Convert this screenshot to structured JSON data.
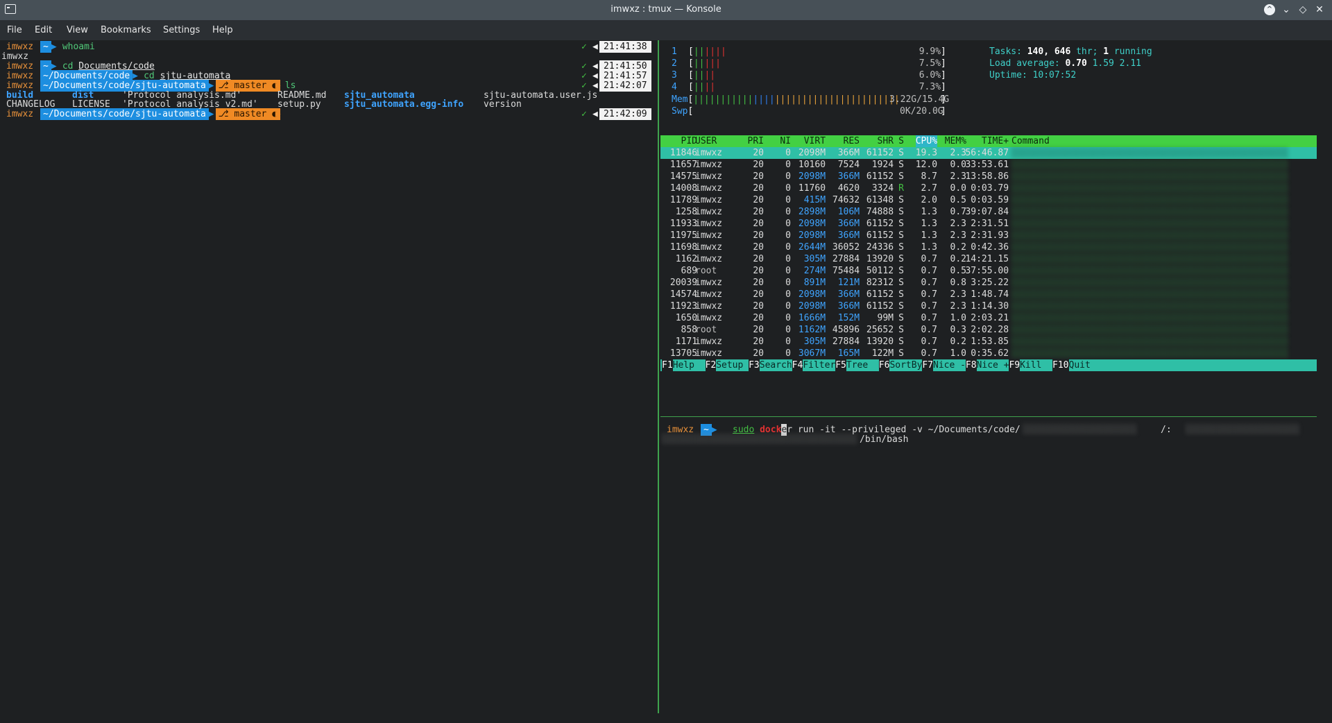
{
  "window": {
    "title": "imwxz : tmux — Konsole",
    "icons": [
      "terminal-icon",
      "keep-above-icon",
      "minimize-icon",
      "maximize-icon",
      "close-icon"
    ]
  },
  "menu": [
    "File",
    "Edit",
    "View",
    "Bookmarks",
    "Settings",
    "Help"
  ],
  "left_pane": {
    "prompts": [
      {
        "user": "imwxz",
        "path": "~",
        "cmd": "whoami",
        "arg": "",
        "branch": "",
        "time": "21:41:38"
      },
      {
        "user": "imwxz",
        "path": "~",
        "cmd": "cd",
        "arg": "Documents/code",
        "branch": "",
        "time": "21:41:50"
      },
      {
        "user": "imwxz",
        "path": "~/Documents/code",
        "cmd": "cd",
        "arg": "sjtu-automata",
        "branch": "",
        "time": "21:41:57"
      },
      {
        "user": "imwxz",
        "path": "~/Documents/code/sjtu-automata",
        "cmd": "ls",
        "arg": "",
        "branch": "master ●",
        "time": "21:42:07"
      },
      {
        "user": "imwxz",
        "path": "~/Documents/code/sjtu-automata",
        "cmd": "",
        "arg": "",
        "branch": "master ●",
        "time": "21:42:09"
      }
    ],
    "whoami_output": "imwxz",
    "ls_row1": [
      "build",
      "dist",
      "'Protocol analysis.md'",
      "README.md",
      "sjtu_automata",
      "sjtu-automata.user.js"
    ],
    "ls_row2": [
      "CHANGELOG",
      "LICENSE",
      "'Protocol analysis v2.md'",
      "setup.py",
      "sjtu_automata.egg-info",
      "version"
    ]
  },
  "htop": {
    "cpus": [
      {
        "n": "1",
        "pct": "9.9%",
        "fill": 0.099
      },
      {
        "n": "2",
        "pct": "7.5%",
        "fill": 0.075
      },
      {
        "n": "3",
        "pct": "6.0%",
        "fill": 0.06
      },
      {
        "n": "4",
        "pct": "7.3%",
        "fill": 0.073
      }
    ],
    "mem_label": "Mem",
    "mem_value": "3.22G/15.4G",
    "swp_label": "Swp",
    "swp_value": "0K/20.0G",
    "tasks_label": "Tasks:",
    "tasks": "140,",
    "thr": "646",
    "thr_label": "thr;",
    "running": "1",
    "running_label": "running",
    "load_label": "Load average:",
    "load1": "0.70",
    "load5": "1.59",
    "load15": "2.11",
    "uptime_label": "Uptime:",
    "uptime": "10:07:52",
    "columns": [
      "PID",
      "USER",
      "PRI",
      "NI",
      "VIRT",
      "RES",
      "SHR",
      "S",
      "CPU%",
      "MEM%",
      "TIME+",
      "Command"
    ],
    "rows": [
      [
        "11846",
        "imwxz",
        "20",
        "0",
        "2098M",
        "366M",
        "61152",
        "S",
        "19.3",
        "2.3",
        "56:46.87"
      ],
      [
        "11657",
        "imwxz",
        "20",
        "0",
        "10160",
        "7524",
        "1924",
        "S",
        "12.0",
        "0.0",
        "33:53.61"
      ],
      [
        "14575",
        "imwxz",
        "20",
        "0",
        "2098M",
        "366M",
        "61152",
        "S",
        "8.7",
        "2.3",
        "13:58.86"
      ],
      [
        "14008",
        "imwxz",
        "20",
        "0",
        "11760",
        "4620",
        "3324",
        "R",
        "2.7",
        "0.0",
        "0:03.79"
      ],
      [
        "11789",
        "imwxz",
        "20",
        "0",
        "415M",
        "74632",
        "61348",
        "S",
        "2.0",
        "0.5",
        "0:03.59"
      ],
      [
        "1258",
        "imwxz",
        "20",
        "0",
        "2898M",
        "106M",
        "74888",
        "S",
        "1.3",
        "0.7",
        "39:07.84"
      ],
      [
        "11933",
        "imwxz",
        "20",
        "0",
        "2098M",
        "366M",
        "61152",
        "S",
        "1.3",
        "2.3",
        "2:31.51"
      ],
      [
        "11975",
        "imwxz",
        "20",
        "0",
        "2098M",
        "366M",
        "61152",
        "S",
        "1.3",
        "2.3",
        "2:31.93"
      ],
      [
        "11698",
        "imwxz",
        "20",
        "0",
        "2644M",
        "36052",
        "24336",
        "S",
        "1.3",
        "0.2",
        "0:42.36"
      ],
      [
        "1162",
        "imwxz",
        "20",
        "0",
        "305M",
        "27884",
        "13920",
        "S",
        "0.7",
        "0.2",
        "14:21.15"
      ],
      [
        "689",
        "root",
        "20",
        "0",
        "274M",
        "75484",
        "50112",
        "S",
        "0.7",
        "0.5",
        "37:55.00"
      ],
      [
        "20039",
        "imwxz",
        "20",
        "0",
        "891M",
        "121M",
        "82312",
        "S",
        "0.7",
        "0.8",
        "3:25.22"
      ],
      [
        "14574",
        "imwxz",
        "20",
        "0",
        "2098M",
        "366M",
        "61152",
        "S",
        "0.7",
        "2.3",
        "1:48.74"
      ],
      [
        "11923",
        "imwxz",
        "20",
        "0",
        "2098M",
        "366M",
        "61152",
        "S",
        "0.7",
        "2.3",
        "1:14.30"
      ],
      [
        "1650",
        "imwxz",
        "20",
        "0",
        "1666M",
        "152M",
        "99M",
        "S",
        "0.7",
        "1.0",
        "2:03.21"
      ],
      [
        "858",
        "root",
        "20",
        "0",
        "1162M",
        "45896",
        "25652",
        "S",
        "0.7",
        "0.3",
        "2:02.28"
      ],
      [
        "1171",
        "imwxz",
        "20",
        "0",
        "305M",
        "27884",
        "13920",
        "S",
        "0.7",
        "0.2",
        "1:53.85"
      ],
      [
        "13705",
        "imwxz",
        "20",
        "0",
        "3067M",
        "165M",
        "122M",
        "S",
        "0.7",
        "1.0",
        "0:35.62"
      ]
    ],
    "fkeys": [
      {
        "key": "F1",
        "label": "Help  "
      },
      {
        "key": "F2",
        "label": "Setup "
      },
      {
        "key": "F3",
        "label": "Search"
      },
      {
        "key": "F4",
        "label": "Filter"
      },
      {
        "key": "F5",
        "label": "Tree  "
      },
      {
        "key": "F6",
        "label": "SortBy"
      },
      {
        "key": "F7",
        "label": "Nice -"
      },
      {
        "key": "F8",
        "label": "Nice +"
      },
      {
        "key": "F9",
        "label": "Kill  "
      },
      {
        "key": "F10",
        "label": "Quit"
      }
    ]
  },
  "bottom_pane": {
    "user": "imwxz",
    "path": "~",
    "sudo": "sudo",
    "dock": "dock",
    "cursor_char": "e",
    "rest": "r run -it --privileged -v ~/Documents/code/",
    "colon": "/:",
    "line2_end": "/bin/bash"
  }
}
